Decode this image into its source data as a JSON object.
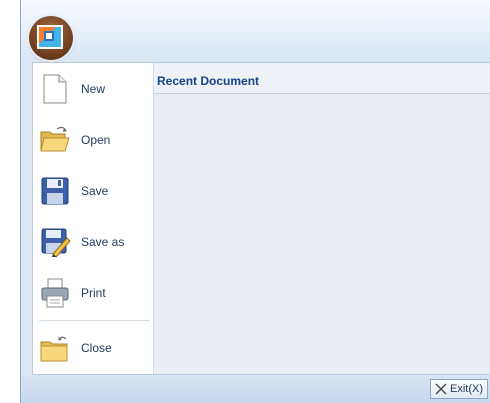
{
  "menu": {
    "items": [
      {
        "label": "New",
        "icon": "new-document-icon"
      },
      {
        "label": "Open",
        "icon": "open-folder-icon"
      },
      {
        "label": "Save",
        "icon": "floppy-disk-icon"
      },
      {
        "label": "Save as",
        "icon": "save-as-icon"
      },
      {
        "label": "Print",
        "icon": "printer-icon"
      },
      {
        "label": "Close",
        "icon": "close-folder-icon"
      }
    ]
  },
  "recent": {
    "title": "Recent Document"
  },
  "footer": {
    "exit_label": "Exit(X)"
  },
  "colors": {
    "accent": "#15428b",
    "frame": "#dce7f4",
    "panel": "#e9edf2"
  }
}
